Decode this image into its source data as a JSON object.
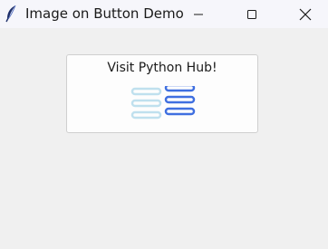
{
  "window": {
    "title": "Image on Button Demo",
    "app_icon": "feather-icon",
    "controls": {
      "minimize_icon": "minimize-icon",
      "maximize_icon": "maximize-icon",
      "close_icon": "close-icon"
    }
  },
  "button": {
    "label": "Visit Python Hub!",
    "image_icon": "menu-lines-icon"
  },
  "colors": {
    "titlebar": "#f6f6fb",
    "client_background": "#f0f0f0",
    "button_background": "#fdfdfd",
    "image_light_blue": "#bfe0ee",
    "image_dark_blue": "#3f6fe0"
  }
}
